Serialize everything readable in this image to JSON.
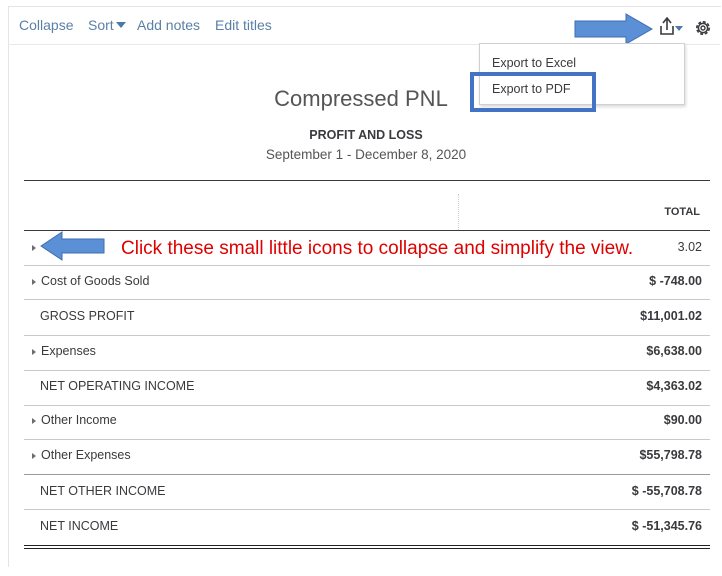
{
  "toolbar": {
    "collapse": "Collapse",
    "sort": "Sort",
    "add_notes": "Add notes",
    "edit_titles": "Edit titles",
    "export_icon": "export-icon",
    "settings_icon": "gear-icon"
  },
  "export_menu": {
    "excel": "Export to Excel",
    "pdf": "Export to PDF"
  },
  "report": {
    "title": "Compressed PNL",
    "subtitle": "PROFIT AND LOSS",
    "date_range": "September 1 - December 8, 2020",
    "total_header": "TOTAL"
  },
  "rows": [
    {
      "label": "",
      "amount": "3.02"
    },
    {
      "label": "Cost of Goods Sold",
      "amount": "$ -748.00"
    },
    {
      "label": "GROSS PROFIT",
      "amount": "$11,001.02"
    },
    {
      "label": "Expenses",
      "amount": "$6,638.00"
    },
    {
      "label": "NET OPERATING INCOME",
      "amount": "$4,363.02"
    },
    {
      "label": "Other Income",
      "amount": "$90.00"
    },
    {
      "label": "Other Expenses",
      "amount": "$55,798.78"
    },
    {
      "label": "NET OTHER INCOME",
      "amount": "$ -55,708.78"
    },
    {
      "label": "NET INCOME",
      "amount": "$ -51,345.76"
    }
  ],
  "annotation": {
    "text": "Click these small little icons to collapse and simplify the view.",
    "color": "#e00000",
    "arrow_color": "#5b8fd6"
  }
}
